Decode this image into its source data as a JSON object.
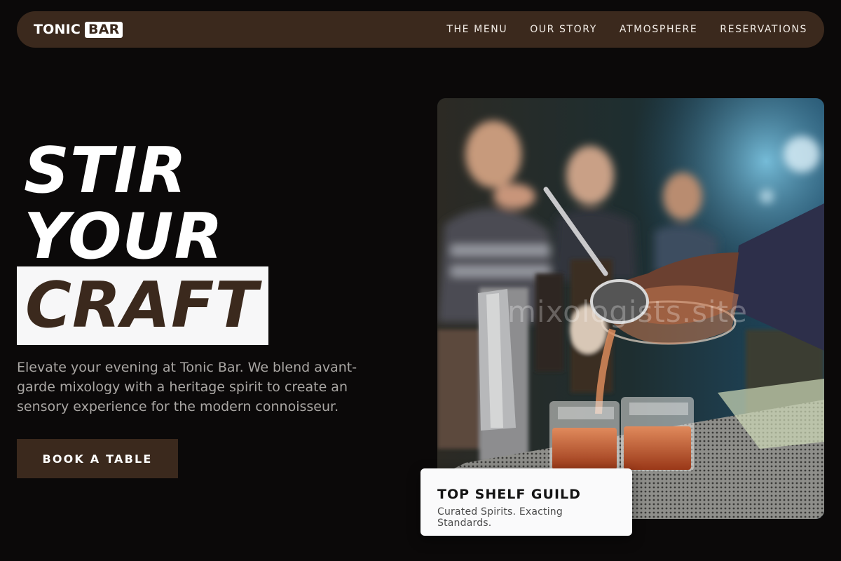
{
  "brand": {
    "word": "TONIC",
    "badge": "BAR"
  },
  "nav": {
    "items": [
      {
        "label": "THE MENU"
      },
      {
        "label": "OUR STORY"
      },
      {
        "label": "ATMOSPHERE"
      },
      {
        "label": "RESERVATIONS"
      }
    ]
  },
  "hero": {
    "line1": "STIR",
    "line2": "YOUR",
    "line3": "CRAFT",
    "lead": "Elevate your evening at Tonic Bar. We blend avant-garde mixology with a heritage spirit to create an sensory experience for the modern connoisseur.",
    "cta": "BOOK A TABLE"
  },
  "photo": {
    "watermark": "mixologists.site"
  },
  "card": {
    "title": "TOP SHELF GUILD",
    "subtitle": "Curated Spirits. Exacting Standards."
  },
  "colors": {
    "background": "#0b0909",
    "brand_brown": "#3b291d",
    "highlight": "#f7f7f8",
    "lead_text": "#a9a6a3"
  }
}
